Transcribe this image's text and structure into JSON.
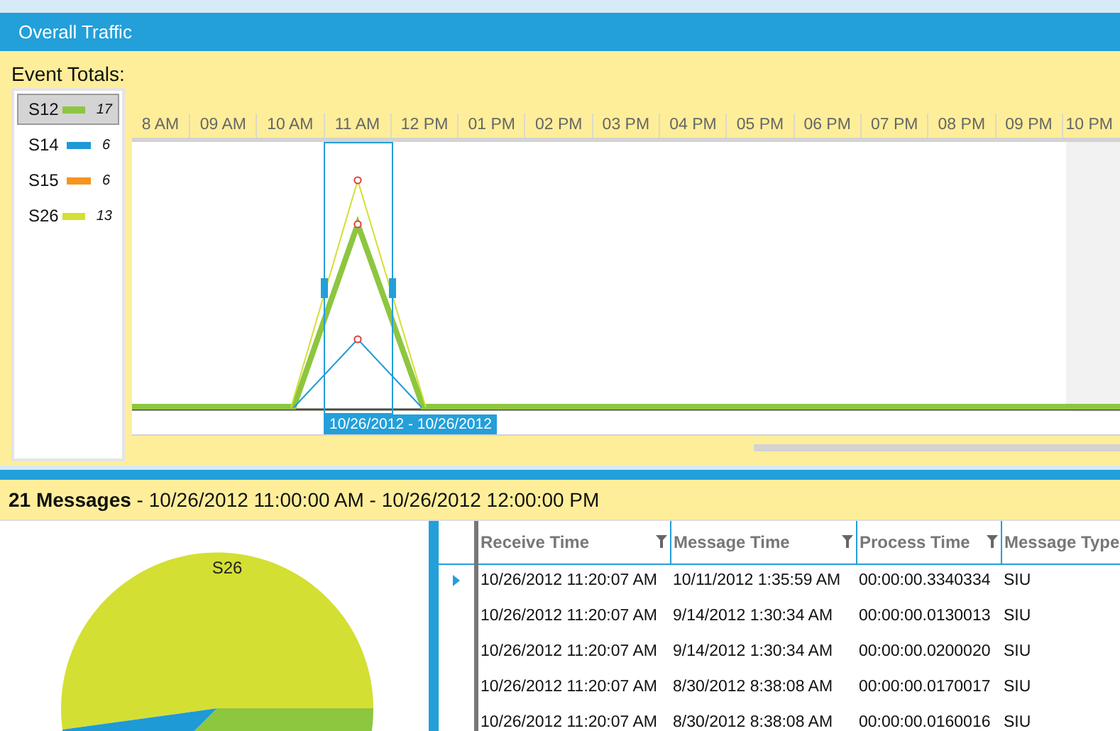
{
  "window": {
    "title": "Overall Traffic"
  },
  "event_totals": {
    "title": "Event Totals:",
    "items": [
      {
        "name": "S12",
        "color": "#8dc63f",
        "count": "17",
        "selected": true
      },
      {
        "name": "S14",
        "color": "#1e9ad6",
        "count": "6",
        "selected": false
      },
      {
        "name": "S15",
        "color": "#f7941d",
        "count": "6",
        "selected": false
      },
      {
        "name": "S26",
        "color": "#d4df33",
        "count": "13",
        "selected": false
      }
    ]
  },
  "timeline": {
    "hours": [
      "8 AM",
      "09 AM",
      "10 AM",
      "11 AM",
      "12 PM",
      "01 PM",
      "02 PM",
      "03 PM",
      "04 PM",
      "05 PM",
      "06 PM",
      "07 PM",
      "08 PM",
      "09 PM",
      "10 PM"
    ],
    "selection_label": "10/26/2012 - 10/26/2012"
  },
  "messages": {
    "summary": "**21 Messages** - 10/26/2012 11:00:00 AM - 10/26/2012 12:00:00 PM"
  },
  "pie": {
    "label": "S26"
  },
  "grid": {
    "columns": [
      {
        "label": "Receive Time",
        "filter": true
      },
      {
        "label": "Message Time",
        "filter": true
      },
      {
        "label": "Process Time",
        "filter": true
      },
      {
        "label": "Message Type"
      }
    ],
    "rows": [
      {
        "current": true,
        "cells": [
          "10/26/2012 11:20:07 AM",
          "10/11/2012 1:35:59 AM",
          "00:00:00.3340334",
          "SIU"
        ]
      },
      {
        "current": false,
        "cells": [
          "10/26/2012 11:20:07 AM",
          "9/14/2012 1:30:34 AM",
          "00:00:00.0130013",
          "SIU"
        ]
      },
      {
        "current": false,
        "cells": [
          "10/26/2012 11:20:07 AM",
          "9/14/2012 1:30:34 AM",
          "00:00:00.0200020",
          "SIU"
        ]
      },
      {
        "current": false,
        "cells": [
          "10/26/2012 11:20:07 AM",
          "8/30/2012 8:38:08 AM",
          "00:00:00.0170017",
          "SIU"
        ]
      },
      {
        "current": false,
        "cells": [
          "10/26/2012 11:20:07 AM",
          "8/30/2012 8:38:08 AM",
          "00:00:00.0160016",
          "SIU"
        ]
      }
    ]
  }
}
